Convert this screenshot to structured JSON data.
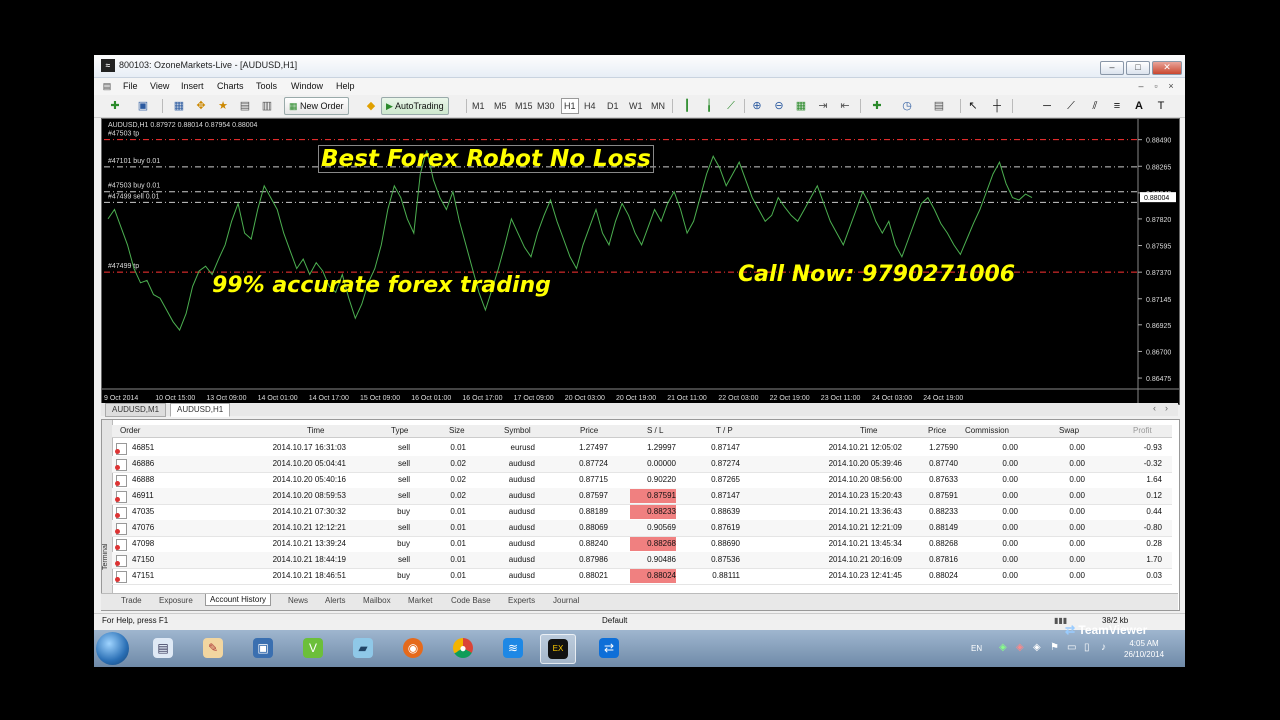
{
  "window": {
    "title": "800103: OzoneMarkets-Live - [AUDUSD,H1]",
    "controls": [
      "–",
      "□",
      "✕"
    ]
  },
  "menu": [
    "File",
    "View",
    "Insert",
    "Charts",
    "Tools",
    "Window",
    "Help"
  ],
  "toolbar": {
    "new_order": "New Order",
    "autotrading": "AutoTrading",
    "timeframes": [
      "M1",
      "M5",
      "M15",
      "M30",
      "H1",
      "H4",
      "D1",
      "W1",
      "MN"
    ]
  },
  "chart": {
    "info": "AUDUSD,H1  0.87972 0.88014 0.87954 0.88004",
    "current_price": "0.88004",
    "overlay_title": "Best Forex Robot No Loss",
    "overlay_accuracy": "99%  accurate forex trading",
    "overlay_call": "Call Now: 9790271006",
    "price_labels": [
      "0.88490",
      "0.88265",
      "0.88040",
      "0.87820",
      "0.87595",
      "0.87370",
      "0.87145",
      "0.86925",
      "0.86700",
      "0.86475"
    ],
    "time_labels": [
      "9 Oct 2014",
      "10 Oct 15:00",
      "13 Oct 09:00",
      "14 Oct 01:00",
      "14 Oct 17:00",
      "15 Oct 09:00",
      "16 Oct 01:00",
      "16 Oct 17:00",
      "17 Oct 09:00",
      "20 Oct 03:00",
      "20 Oct 19:00",
      "21 Oct 11:00",
      "22 Oct 03:00",
      "22 Oct 19:00",
      "23 Oct 11:00",
      "24 Oct 03:00",
      "24 Oct 19:00"
    ],
    "order_lines": [
      {
        "label": "#47503 tp",
        "price": 0.8849,
        "color": "#ff3333",
        "style": "dash-dot"
      },
      {
        "label": "#47101 buy 0.01",
        "price": 0.8826,
        "color": "#cccccc",
        "style": "dash-dot"
      },
      {
        "label": "#47503 buy 0.01",
        "price": 0.8805,
        "color": "#cccccc",
        "style": "dash-dot"
      },
      {
        "label": "#47499 sell 0.01",
        "price": 0.8796,
        "color": "#cccccc",
        "style": "dash-dot"
      },
      {
        "label": "#47499 tp",
        "price": 0.8737,
        "color": "#ff3333",
        "style": "dash-dot"
      }
    ],
    "series_color": "#4caf50",
    "price_series": [
      0.8782,
      0.879,
      0.8775,
      0.876,
      0.874,
      0.8728,
      0.873,
      0.8718,
      0.8715,
      0.8705,
      0.8695,
      0.8688,
      0.8702,
      0.8725,
      0.8738,
      0.8742,
      0.8735,
      0.8748,
      0.876,
      0.878,
      0.8795,
      0.877,
      0.8765,
      0.879,
      0.881,
      0.88,
      0.879,
      0.877,
      0.8755,
      0.874,
      0.8748,
      0.8735,
      0.8745,
      0.8738,
      0.8725,
      0.872,
      0.8735,
      0.8715,
      0.8698,
      0.871,
      0.8728,
      0.874,
      0.876,
      0.879,
      0.881,
      0.88,
      0.8782,
      0.877,
      0.882,
      0.884,
      0.8815,
      0.88,
      0.879,
      0.8805,
      0.878,
      0.876,
      0.874,
      0.872,
      0.8705,
      0.8722,
      0.874,
      0.876,
      0.8782,
      0.877,
      0.8758,
      0.875,
      0.877,
      0.8785,
      0.8798,
      0.878,
      0.8765,
      0.875,
      0.874,
      0.876,
      0.8775,
      0.879,
      0.877,
      0.876,
      0.878,
      0.8795,
      0.8785,
      0.877,
      0.876,
      0.8775,
      0.879,
      0.878,
      0.8795,
      0.8805,
      0.879,
      0.877,
      0.878,
      0.88,
      0.882,
      0.8835,
      0.8825,
      0.881,
      0.882,
      0.883,
      0.8815,
      0.88,
      0.879,
      0.878,
      0.8785,
      0.88,
      0.8792,
      0.8785,
      0.878,
      0.879,
      0.88,
      0.881,
      0.8795,
      0.878,
      0.877,
      0.876,
      0.8775,
      0.879,
      0.8805,
      0.8795,
      0.878,
      0.877,
      0.878,
      0.876,
      0.875,
      0.8765,
      0.878,
      0.8795,
      0.88,
      0.879,
      0.8778,
      0.877,
      0.876,
      0.8752,
      0.8765,
      0.8778,
      0.879,
      0.8805,
      0.882,
      0.883,
      0.8812,
      0.88,
      0.8798,
      0.8803,
      0.88
    ]
  },
  "chart_tabs": [
    "AUDUSD,M1",
    "AUDUSD,H1"
  ],
  "terminal": {
    "side_label": "Terminal",
    "columns": [
      "Order",
      "Time",
      "Type",
      "Size",
      "Symbol",
      "Price",
      "S / L",
      "T / P",
      "Time",
      "Price",
      "Commission",
      "Swap",
      "Profit"
    ],
    "rows": [
      {
        "order": "46851",
        "time": "2014.10.17 16:31:03",
        "type": "sell",
        "size": "0.01",
        "symbol": "eurusd",
        "price": "1.27497",
        "sl": "1.29997",
        "tp": "0.87147",
        "close_time": "2014.10.21 12:05:02",
        "close_price": "1.27590",
        "commission": "0.00",
        "swap": "0.00",
        "profit": "-0.93",
        "sl_hit": false
      },
      {
        "order": "46886",
        "time": "2014.10.20 05:04:41",
        "type": "sell",
        "size": "0.02",
        "symbol": "audusd",
        "price": "0.87724",
        "sl": "0.00000",
        "tp": "0.87274",
        "close_time": "2014.10.20 05:39:46",
        "close_price": "0.87740",
        "commission": "0.00",
        "swap": "0.00",
        "profit": "-0.32",
        "sl_hit": false
      },
      {
        "order": "46888",
        "time": "2014.10.20 05:40:16",
        "type": "sell",
        "size": "0.02",
        "symbol": "audusd",
        "price": "0.87715",
        "sl": "0.90220",
        "tp": "0.87265",
        "close_time": "2014.10.20 08:56:00",
        "close_price": "0.87633",
        "commission": "0.00",
        "swap": "0.00",
        "profit": "1.64",
        "sl_hit": false
      },
      {
        "order": "46911",
        "time": "2014.10.20 08:59:53",
        "type": "sell",
        "size": "0.02",
        "symbol": "audusd",
        "price": "0.87597",
        "sl": "0.87591",
        "tp": "0.87147",
        "close_time": "2014.10.23 15:20:43",
        "close_price": "0.87591",
        "commission": "0.00",
        "swap": "0.00",
        "profit": "0.12",
        "sl_hit": true
      },
      {
        "order": "47035",
        "time": "2014.10.21 07:30:32",
        "type": "buy",
        "size": "0.01",
        "symbol": "audusd",
        "price": "0.88189",
        "sl": "0.88233",
        "tp": "0.88639",
        "close_time": "2014.10.21 13:36:43",
        "close_price": "0.88233",
        "commission": "0.00",
        "swap": "0.00",
        "profit": "0.44",
        "sl_hit": true
      },
      {
        "order": "47076",
        "time": "2014.10.21 12:12:21",
        "type": "sell",
        "size": "0.01",
        "symbol": "audusd",
        "price": "0.88069",
        "sl": "0.90569",
        "tp": "0.87619",
        "close_time": "2014.10.21 12:21:09",
        "close_price": "0.88149",
        "commission": "0.00",
        "swap": "0.00",
        "profit": "-0.80",
        "sl_hit": false
      },
      {
        "order": "47098",
        "time": "2014.10.21 13:39:24",
        "type": "buy",
        "size": "0.01",
        "symbol": "audusd",
        "price": "0.88240",
        "sl": "0.88268",
        "tp": "0.88690",
        "close_time": "2014.10.21 13:45:34",
        "close_price": "0.88268",
        "commission": "0.00",
        "swap": "0.00",
        "profit": "0.28",
        "sl_hit": true
      },
      {
        "order": "47150",
        "time": "2014.10.21 18:44:19",
        "type": "sell",
        "size": "0.01",
        "symbol": "audusd",
        "price": "0.87986",
        "sl": "0.90486",
        "tp": "0.87536",
        "close_time": "2014.10.21 20:16:09",
        "close_price": "0.87816",
        "commission": "0.00",
        "swap": "0.00",
        "profit": "1.70",
        "sl_hit": false
      },
      {
        "order": "47151",
        "time": "2014.10.21 18:46:51",
        "type": "buy",
        "size": "0.01",
        "symbol": "audusd",
        "price": "0.88021",
        "sl": "0.88024",
        "tp": "0.88111",
        "close_time": "2014.10.23 12:41:45",
        "close_price": "0.88024",
        "commission": "0.00",
        "swap": "0.00",
        "profit": "0.03",
        "sl_hit": true
      }
    ],
    "tabs": [
      "Trade",
      "Exposure",
      "Account History",
      "News",
      "Alerts",
      "Mailbox",
      "Market",
      "Code Base",
      "Experts",
      "Journal"
    ],
    "active_tab": "Account History"
  },
  "statusbar": {
    "help": "For Help, press F1",
    "profile": "Default",
    "traffic": "38/2 kb"
  },
  "taskbar": {
    "apps": [
      "start",
      "notepad",
      "paint",
      "network",
      "vuze",
      "slideshow",
      "firefox",
      "chrome",
      "wifi",
      "exness",
      "teamviewer"
    ],
    "language": "EN",
    "time": "4:05 AM",
    "date": "26/10/2014"
  },
  "watermark": "TeamViewer"
}
